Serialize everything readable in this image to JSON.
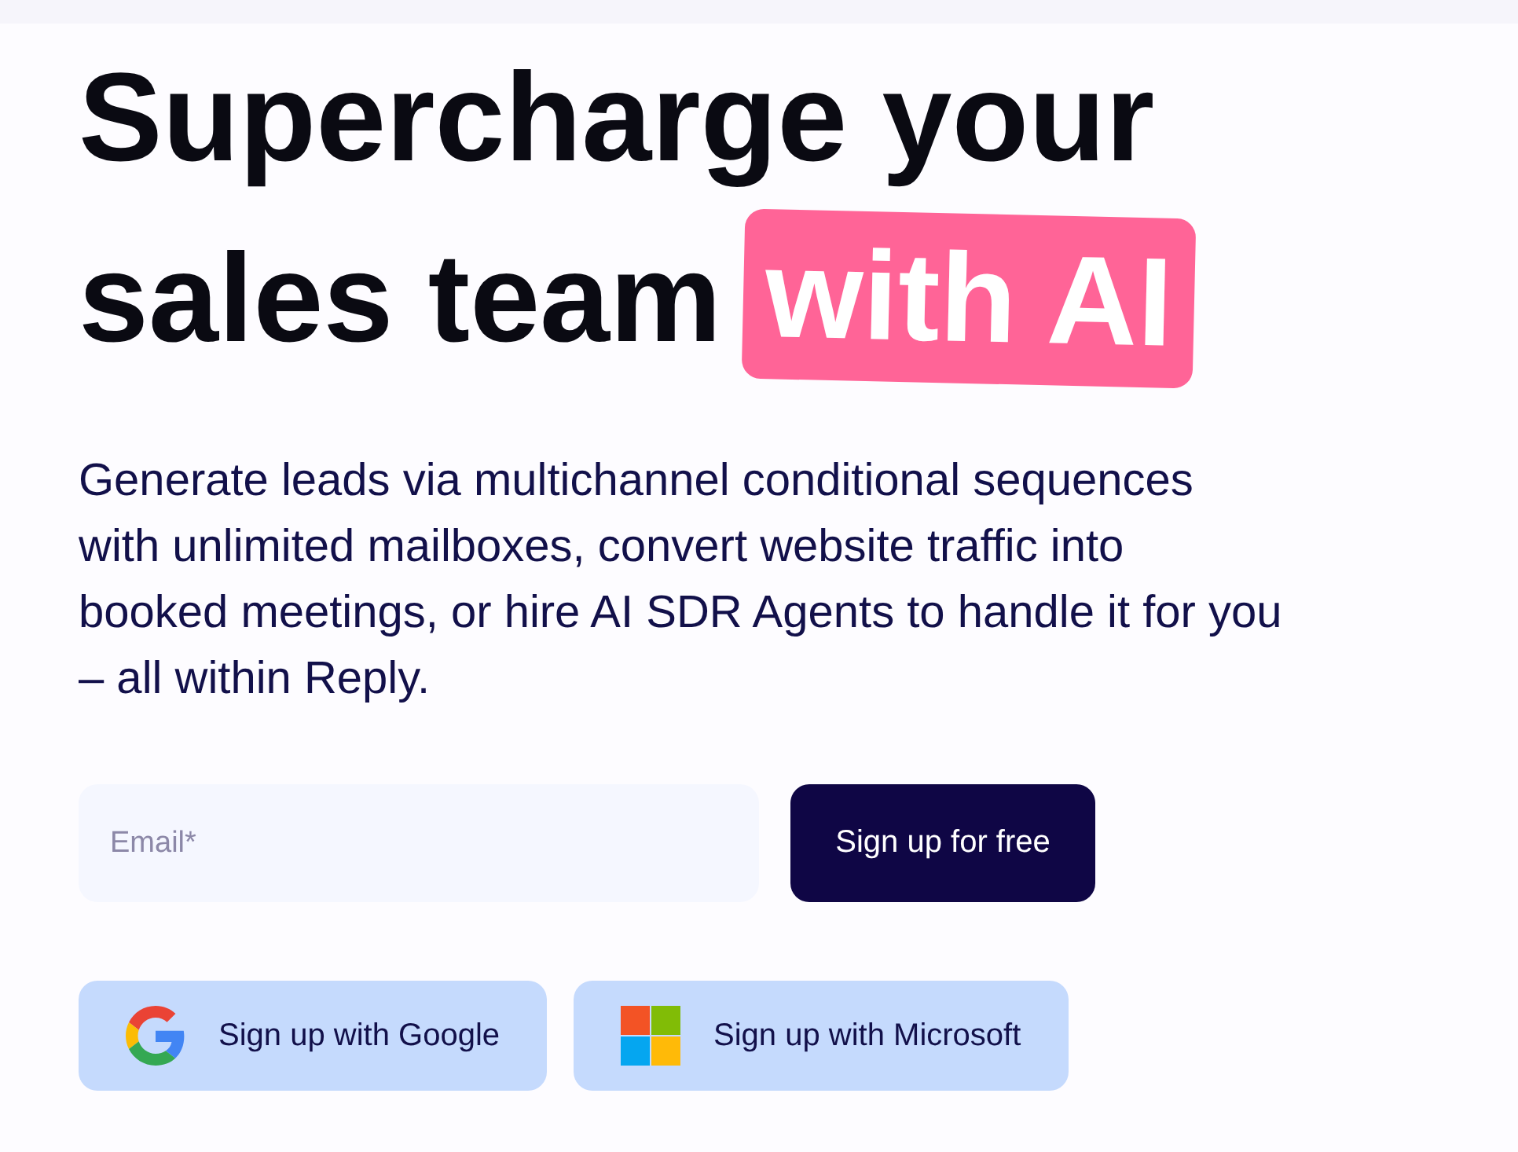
{
  "heading": {
    "lines": [
      "Supercharge your",
      "sales team"
    ],
    "highlight": "with AI"
  },
  "description": "Generate leads via multichannel conditional sequences with unlimited mailboxes, convert website traffic into booked meetings, or hire AI SDR Agents to handle it for you – all within Reply.",
  "signup_form": {
    "email": {
      "placeholder": "Email*"
    },
    "submit": "Sign up for free"
  },
  "oauth_buttons": [
    {
      "kind": "google",
      "label": "Sign up with Google"
    },
    {
      "kind": "microsoft",
      "label": "Sign up with Microsoft"
    }
  ]
}
